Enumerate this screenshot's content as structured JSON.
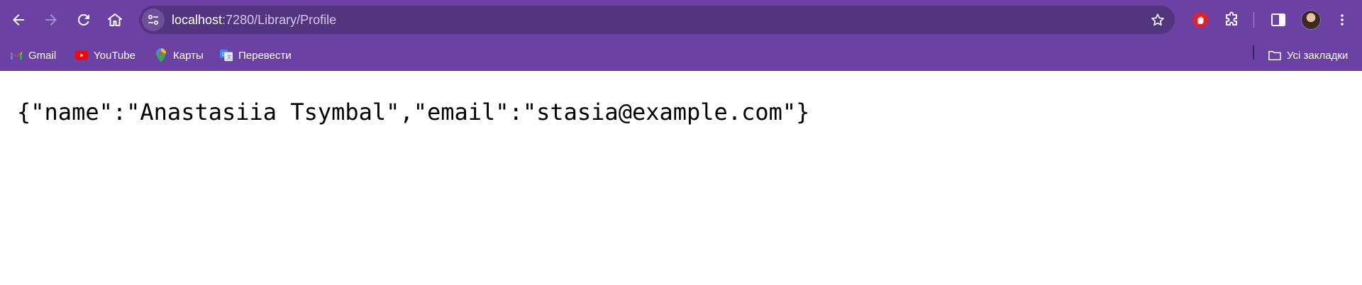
{
  "browser": {
    "url_host": "localhost",
    "url_rest": ":7280/Library/Profile"
  },
  "bookmarks": [
    {
      "label": "Gmail",
      "icon": "gmail-icon"
    },
    {
      "label": "YouTube",
      "icon": "youtube-icon"
    },
    {
      "label": "Карты",
      "icon": "maps-icon"
    },
    {
      "label": "Перевести",
      "icon": "translate-icon"
    }
  ],
  "all_bookmarks_label": "Усі закладки",
  "page": {
    "json_text": "{\"name\":\"Anastasiia Tsymbal\",\"email\":\"stasia@example.com\"}"
  },
  "colors": {
    "toolbar": "#6b41a4",
    "omnibox": "#53357f"
  }
}
